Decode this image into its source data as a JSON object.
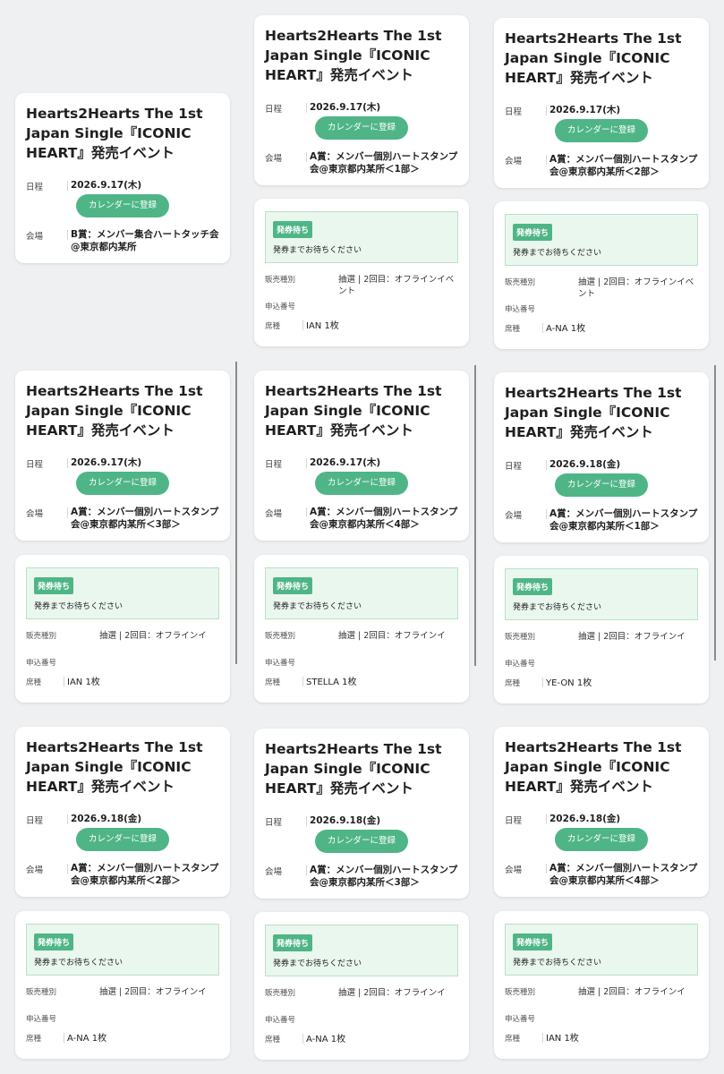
{
  "labels": {
    "date": "日程",
    "venue": "会場",
    "calendar_button": "カレンダーに登録",
    "sales_type": "販売種別",
    "application_no": "申込番号",
    "seat_type": "席種"
  },
  "cards": [
    {
      "title": "Hearts2Hearts The 1st Japan Single『ICONIC HEART』発売イベント",
      "date": "2026.9.17(木)",
      "venue": "B賞：メンバー集合ハートタッチ会@東京都内某所"
    },
    {
      "title": "Hearts2Hearts The 1st Japan Single『ICONIC HEART』発売イベント",
      "date": "2026.9.17(木)",
      "venue": "A賞：メンバー個別ハートスタンプ会@東京都内某所＜1部＞",
      "ticket": {
        "status": "発券待ち",
        "message": "発券までお待ちください",
        "sales": "抽選 | 2回目：オフラインイベント",
        "appno": "",
        "seat": "IAN 1枚"
      }
    },
    {
      "title": "Hearts2Hearts The 1st Japan Single『ICONIC HEART』発売イベント",
      "date": "2026.9.17(木)",
      "venue": "A賞：メンバー個別ハートスタンプ会@東京都内某所＜2部＞",
      "ticket": {
        "status": "発券待ち",
        "message": "発券までお待ちください",
        "sales": "抽選 | 2回目：オフラインイベント",
        "appno": "",
        "seat": "A-NA 1枚"
      }
    },
    {
      "title": "Hearts2Hearts The 1st Japan Single『ICONIC HEART』発売イベント",
      "date": "2026.9.17(木)",
      "venue": "A賞：メンバー個別ハートスタンプ会@東京都内某所＜3部＞",
      "ticket": {
        "status": "発券待ち",
        "message": "発券までお待ちください",
        "sales": "抽選 | 2回目：オフラインイ",
        "appno": "",
        "seat": "IAN 1枚"
      }
    },
    {
      "title": "Hearts2Hearts The 1st Japan Single『ICONIC HEART』発売イベント",
      "date": "2026.9.17(木)",
      "venue": "A賞：メンバー個別ハートスタンプ会@東京都内某所＜4部＞",
      "ticket": {
        "status": "発券待ち",
        "message": "発券までお待ちください",
        "sales": "抽選 | 2回目：オフラインイ",
        "appno": "",
        "seat": "STELLA 1枚"
      }
    },
    {
      "title": "Hearts2Hearts The 1st Japan Single『ICONIC HEART』発売イベント",
      "date": "2026.9.18(金)",
      "venue": "A賞：メンバー個別ハートスタンプ会@東京都内某所＜1部＞",
      "ticket": {
        "status": "発券待ち",
        "message": "発券までお待ちください",
        "sales": "抽選 | 2回目：オフラインイ",
        "appno": "",
        "seat": "YE-ON 1枚"
      }
    },
    {
      "title": "Hearts2Hearts The 1st Japan Single『ICONIC HEART』発売イベント",
      "date": "2026.9.18(金)",
      "venue": "A賞：メンバー個別ハートスタンプ会@東京都内某所＜2部＞",
      "ticket": {
        "status": "発券待ち",
        "message": "発券までお待ちください",
        "sales": "抽選 | 2回目：オフラインイ",
        "appno": "",
        "seat": "A-NA 1枚"
      }
    },
    {
      "title": "Hearts2Hearts The 1st Japan Single『ICONIC HEART』発売イベント",
      "date": "2026.9.18(金)",
      "venue": "A賞：メンバー個別ハートスタンプ会@東京都内某所＜3部＞",
      "ticket": {
        "status": "発券待ち",
        "message": "発券までお待ちください",
        "sales": "抽選 | 2回目：オフラインイ",
        "appno": "",
        "seat": "A-NA 1枚"
      }
    },
    {
      "title": "Hearts2Hearts The 1st Japan Single『ICONIC HEART』発売イベント",
      "date": "2026.9.18(金)",
      "venue": "A賞：メンバー個別ハートスタンプ会@東京都内某所＜4部＞",
      "ticket": {
        "status": "発券待ち",
        "message": "発券までお待ちください",
        "sales": "抽選 | 2回目：オフラインイ",
        "appno": "",
        "seat": "IAN 1枚"
      }
    }
  ]
}
